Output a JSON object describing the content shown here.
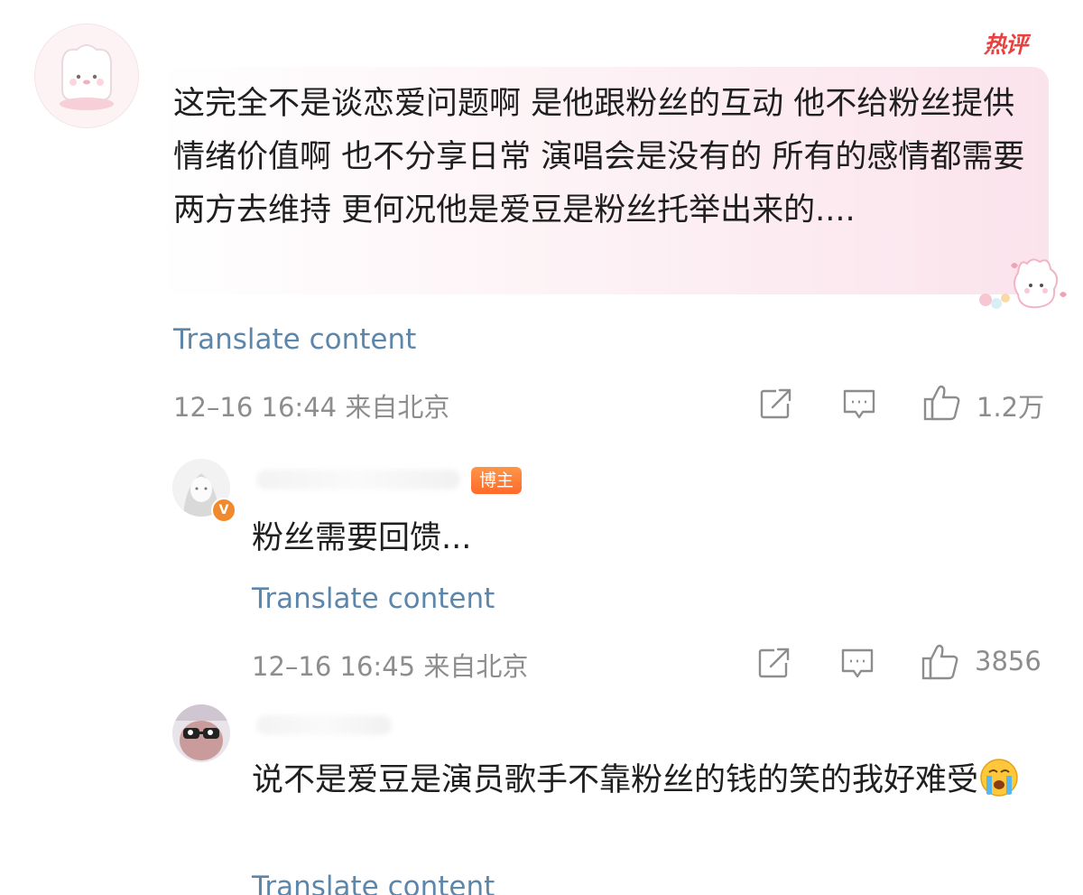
{
  "hot_badge": "热评",
  "main_comment": {
    "text": "这完全不是谈恋爱问题啊 是他跟粉丝的互动 他不给粉丝提供情绪价值啊 也不分享日常 演唱会是没有的 所有的感情都需要两方去维持 更何况他是爱豆是粉丝托举出来的....",
    "translate_label": "Translate content",
    "meta": "12–16 16:44 来自北京",
    "like_count": "1.2万"
  },
  "reply_1": {
    "badge": "博主",
    "verify_mark": "V",
    "text": "粉丝需要回馈...",
    "translate_label": "Translate content",
    "meta": "12–16 16:45 来自北京",
    "like_count": "3856"
  },
  "reply_2": {
    "text": "说不是爱豆是演员歌手不靠粉丝的钱的笑的我好难受",
    "translate_label": "Translate content"
  },
  "icons": {
    "share": "share-icon",
    "comment": "comment-icon",
    "like": "thumbs-up-icon",
    "crying_emoji": "crying-emoji-icon"
  },
  "colors": {
    "link": "#5d86ab",
    "meta": "#8d8d8d",
    "hot": "#e8413e",
    "badge": "#ff7a36"
  }
}
